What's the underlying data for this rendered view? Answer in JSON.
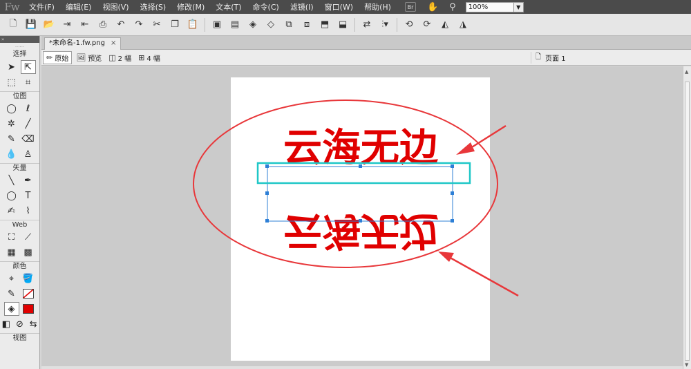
{
  "app": {
    "logo": "Fw"
  },
  "menu": {
    "items": [
      "文件(F)",
      "编辑(E)",
      "视图(V)",
      "选择(S)",
      "修改(M)",
      "文本(T)",
      "命令(C)",
      "滤镜(I)",
      "窗口(W)",
      "帮助(H)"
    ],
    "bridge_badge": "Br",
    "zoom_value": "100%"
  },
  "tools": {
    "strip_text": "»",
    "grip_text": "......",
    "sections": {
      "select": "选择",
      "bitmap": "位图",
      "vector": "矢量",
      "web": "Web",
      "color": "颜色",
      "view": "视图"
    },
    "text_tool_glyph": "T"
  },
  "document": {
    "tab_title": "*未命名-1.fw.png",
    "tab_close": "×"
  },
  "view_bar": {
    "original": "原始",
    "preview": "预览",
    "two_up": "2 幅",
    "four_up": "4 幅",
    "page": "页面 1"
  },
  "canvas": {
    "text_top": "云海无边",
    "text_reflection": "云海无边"
  },
  "colors": {
    "accent_red": "#e00000",
    "annotation_red": "#e8373a",
    "selection_cyan": "#1fc7c7",
    "selection_blue": "#2d7fd6",
    "menubar_bg": "#4b4b4b"
  }
}
